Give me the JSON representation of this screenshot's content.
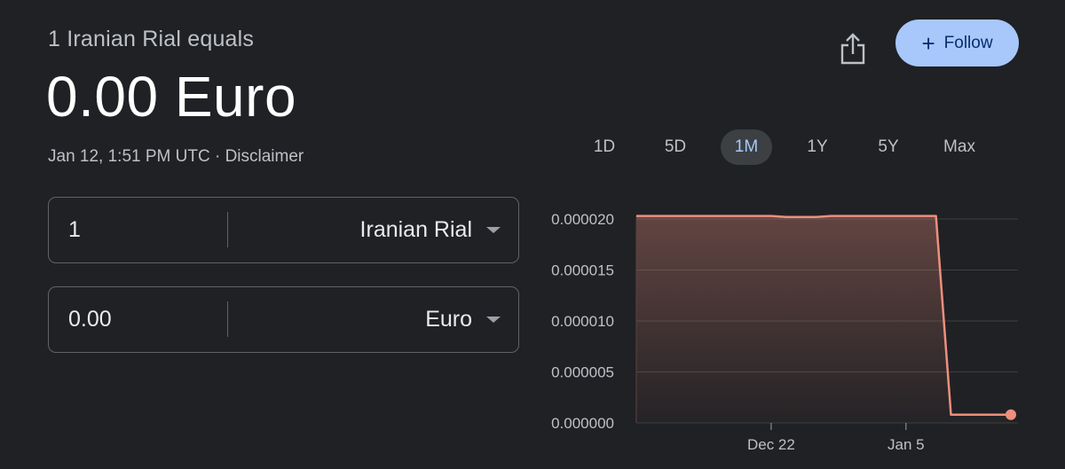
{
  "header": {
    "headline": "1 Iranian Rial equals",
    "result": "0.00 Euro",
    "timestamp": "Jan 12, 1:51 PM UTC · Disclaimer"
  },
  "actions": {
    "follow_label": "Follow"
  },
  "range_tabs": [
    {
      "label": "1D",
      "active": false
    },
    {
      "label": "5D",
      "active": false
    },
    {
      "label": "1M",
      "active": true
    },
    {
      "label": "1Y",
      "active": false
    },
    {
      "label": "5Y",
      "active": false
    },
    {
      "label": "Max",
      "active": false
    }
  ],
  "converter": {
    "from": {
      "amount": "1",
      "currency": "Iranian Rial"
    },
    "to": {
      "amount": "0.00",
      "currency": "Euro"
    }
  },
  "colors": {
    "accent": "#a8c7fa",
    "line": "#ee8f7e",
    "background": "#202124"
  },
  "chart_data": {
    "type": "area",
    "x_tick_labels": [
      "Dec 22",
      "Jan 5"
    ],
    "y_tick_labels": [
      "0.000020",
      "0.000015",
      "0.000010",
      "0.000005",
      "0.000000"
    ],
    "ylim": [
      0,
      2e-05
    ],
    "grid": true,
    "series": [
      {
        "x": [
          0,
          1,
          2,
          3,
          4,
          5,
          6,
          7,
          8,
          9,
          10,
          11,
          12,
          13,
          14,
          15,
          16,
          17,
          18,
          19,
          20,
          21,
          22,
          23,
          24,
          25
        ],
        "values": [
          2.03e-05,
          2.03e-05,
          2.03e-05,
          2.03e-05,
          2.03e-05,
          2.03e-05,
          2.03e-05,
          2.03e-05,
          2.03e-05,
          2.03e-05,
          2.02e-05,
          2.02e-05,
          2.02e-05,
          2.03e-05,
          2.03e-05,
          2.03e-05,
          2.03e-05,
          2.03e-05,
          2.03e-05,
          2.03e-05,
          2.03e-05,
          8e-07,
          8e-07,
          8e-07,
          8e-07,
          8e-07
        ]
      }
    ],
    "x_tick_positions": [
      9,
      18
    ]
  }
}
